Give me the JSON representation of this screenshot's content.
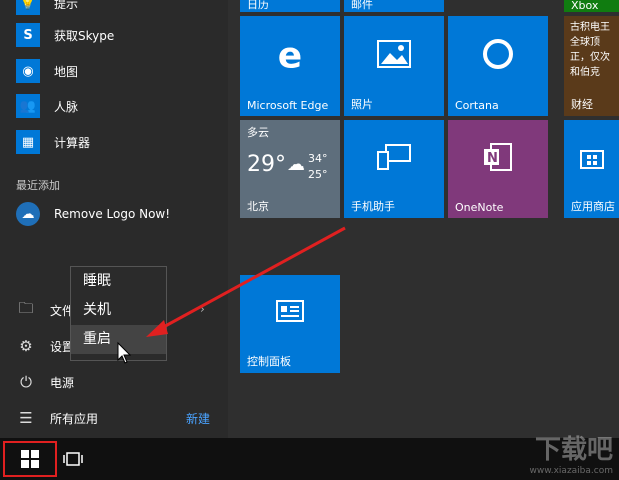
{
  "left": {
    "apps": [
      {
        "label": "提示",
        "icon": "tips-icon"
      },
      {
        "label": "获取Skype",
        "icon": "skype-icon"
      },
      {
        "label": "地图",
        "icon": "maps-icon"
      },
      {
        "label": "人脉",
        "icon": "people-icon"
      },
      {
        "label": "计算器",
        "icon": "calculator-icon"
      }
    ],
    "recent_header": "最近添加",
    "recent_app": "Remove Logo Now!",
    "bottom": [
      {
        "label": "文件资源管理器",
        "icon": "file-explorer-icon"
      },
      {
        "label": "设置",
        "icon": "gear-icon"
      },
      {
        "label": "电源",
        "icon": "power-icon"
      },
      {
        "label": "所有应用",
        "icon": "list-icon"
      }
    ],
    "new_label": "新建"
  },
  "power_menu": {
    "items": [
      "睡眠",
      "关机",
      "重启"
    ],
    "highlighted": "重启"
  },
  "tiles": {
    "top_left_partial": "日历",
    "top_mid_partial": "邮件",
    "xbox": "Xbox",
    "edge": "Microsoft Edge",
    "photos": "照片",
    "cortana": "Cortana",
    "news": "财经",
    "news_text": "古积电王 全球顶 正，仅次 和伯克",
    "weather_cond": "多云",
    "weather_temp": "29°",
    "weather_high": "34°",
    "weather_low": "25°",
    "weather_city": "北京",
    "phone": "手机助手",
    "onenote": "OneNote",
    "store": "应用商店",
    "control": "控制面板"
  },
  "watermark": {
    "brand": "下载吧",
    "url": "www.xiazaiba.com"
  },
  "colors": {
    "tile_blue": "#0078d7",
    "onenote_purple": "#80397b",
    "red_highlight": "#e02020"
  }
}
